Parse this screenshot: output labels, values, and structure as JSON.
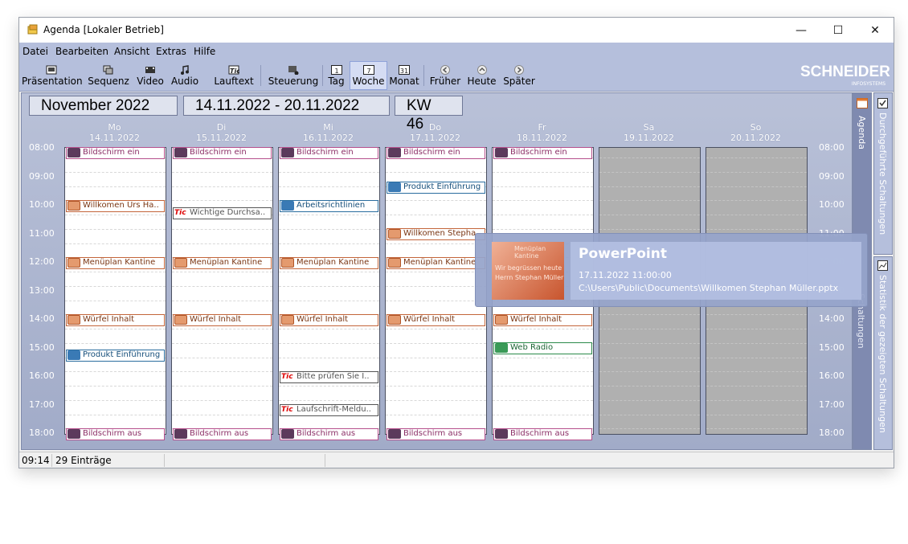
{
  "window": {
    "title": "Agenda [Lokaler Betrieb]",
    "minimize": "—",
    "maximize": "☐",
    "close": "✕"
  },
  "menu": [
    "Datei",
    "Bearbeiten",
    "Ansicht",
    "Extras",
    "Hilfe"
  ],
  "toolbar": {
    "items": [
      {
        "label": "Präsentation",
        "icon": "presentation-icon"
      },
      {
        "label": "Sequenz",
        "icon": "sequence-icon"
      },
      {
        "label": "Video",
        "icon": "video-icon"
      },
      {
        "label": "Audio",
        "icon": "audio-icon"
      },
      {
        "label": "Lauftext",
        "icon": "ticker-icon"
      },
      {
        "label": "Steuerung",
        "icon": "control-icon"
      },
      {
        "label": "Tag",
        "icon": "day-icon",
        "icon_text": "1"
      },
      {
        "label": "Woche",
        "icon": "week-icon",
        "icon_text": "7",
        "active": true
      },
      {
        "label": "Monat",
        "icon": "month-icon",
        "icon_text": "31"
      },
      {
        "label": "Früher",
        "icon": "earlier-icon"
      },
      {
        "label": "Heute",
        "icon": "today-icon"
      },
      {
        "label": "Später",
        "icon": "later-icon"
      }
    ],
    "logo": "SCHNEIDER",
    "logo_sub": "INFOSYSTEMS"
  },
  "header": {
    "month": "November 2022",
    "range": "14.11.2022 - 20.11.2022",
    "week": "KW 46"
  },
  "days": [
    {
      "name": "Mo",
      "date": "14.11.2022",
      "weekend": false
    },
    {
      "name": "Di",
      "date": "15.11.2022",
      "weekend": false
    },
    {
      "name": "Mi",
      "date": "16.11.2022",
      "weekend": false
    },
    {
      "name": "Do",
      "date": "17.11.2022",
      "weekend": false
    },
    {
      "name": "Fr",
      "date": "18.11.2022",
      "weekend": false
    },
    {
      "name": "Sa",
      "date": "19.11.2022",
      "weekend": true
    },
    {
      "name": "So",
      "date": "20.11.2022",
      "weekend": true
    }
  ],
  "hours": [
    "08:00",
    "09:00",
    "10:00",
    "11:00",
    "12:00",
    "13:00",
    "14:00",
    "15:00",
    "16:00",
    "17:00",
    "18:00"
  ],
  "events": [
    {
      "day": 0,
      "time": 8.0,
      "label": "Bildschirm ein",
      "kind": "screen"
    },
    {
      "day": 1,
      "time": 8.0,
      "label": "Bildschirm ein",
      "kind": "screen"
    },
    {
      "day": 2,
      "time": 8.0,
      "label": "Bildschirm ein",
      "kind": "screen"
    },
    {
      "day": 3,
      "time": 8.0,
      "label": "Bildschirm ein",
      "kind": "screen"
    },
    {
      "day": 4,
      "time": 8.0,
      "label": "Bildschirm ein",
      "kind": "screen"
    },
    {
      "day": 3,
      "time": 9.2,
      "label": "Produkt Einführung",
      "kind": "video"
    },
    {
      "day": 0,
      "time": 9.85,
      "label": "Willkomen Urs Ha..",
      "kind": "ppt"
    },
    {
      "day": 1,
      "time": 10.1,
      "label": "Wichtige Durchsa..",
      "kind": "tick"
    },
    {
      "day": 2,
      "time": 9.85,
      "label": "Arbeitsrichtlinien",
      "kind": "video"
    },
    {
      "day": 3,
      "time": 10.85,
      "label": "Willkomen Stepha",
      "kind": "ppt"
    },
    {
      "day": 0,
      "time": 11.85,
      "label": "Menüplan Kantine",
      "kind": "ppt"
    },
    {
      "day": 1,
      "time": 11.85,
      "label": "Menüplan Kantine",
      "kind": "ppt"
    },
    {
      "day": 2,
      "time": 11.85,
      "label": "Menüplan Kantine",
      "kind": "ppt"
    },
    {
      "day": 3,
      "time": 11.85,
      "label": "Menüplan Kantine",
      "kind": "ppt"
    },
    {
      "day": 0,
      "time": 13.85,
      "label": "Würfel Inhalt",
      "kind": "ppt"
    },
    {
      "day": 1,
      "time": 13.85,
      "label": "Würfel Inhalt",
      "kind": "ppt"
    },
    {
      "day": 2,
      "time": 13.85,
      "label": "Würfel Inhalt",
      "kind": "ppt"
    },
    {
      "day": 3,
      "time": 13.85,
      "label": "Würfel Inhalt",
      "kind": "ppt"
    },
    {
      "day": 4,
      "time": 13.85,
      "label": "Würfel Inhalt",
      "kind": "ppt"
    },
    {
      "day": 0,
      "time": 15.1,
      "label": "Produkt Einführung",
      "kind": "video"
    },
    {
      "day": 4,
      "time": 14.85,
      "label": "Web Radio",
      "kind": "audio"
    },
    {
      "day": 2,
      "time": 15.85,
      "label": "Bitte prüfen Sie I..",
      "kind": "tick"
    },
    {
      "day": 2,
      "time": 17.0,
      "label": "Laufschrift-Meldu..",
      "kind": "tick"
    },
    {
      "day": 0,
      "time": 17.85,
      "label": "Bildschirm aus",
      "kind": "screen"
    },
    {
      "day": 1,
      "time": 17.85,
      "label": "Bildschirm aus",
      "kind": "screen"
    },
    {
      "day": 2,
      "time": 17.85,
      "label": "Bildschirm aus",
      "kind": "screen"
    },
    {
      "day": 3,
      "time": 17.85,
      "label": "Bildschirm aus",
      "kind": "screen"
    },
    {
      "day": 4,
      "time": 17.85,
      "label": "Bildschirm aus",
      "kind": "screen"
    }
  ],
  "side_tabs": {
    "agenda": "Agenda",
    "done": "Durchgeführte Schaltungen",
    "stats": "Statistik der gezeigten Schaltungen",
    "partial": "Schaltungen"
  },
  "tooltip": {
    "title": "PowerPoint",
    "datetime": "17.11.2022 11:00:00",
    "path": "C:\\Users\\Public\\Documents\\Willkomen Stephan Müller.pptx",
    "thumb_line1": "Wir begrüssen heute",
    "thumb_line2": "Herrn Stephan Müller",
    "ghost_label": "Menüplan Kantine"
  },
  "status": {
    "time": "09:14",
    "count": "29 Einträge"
  }
}
